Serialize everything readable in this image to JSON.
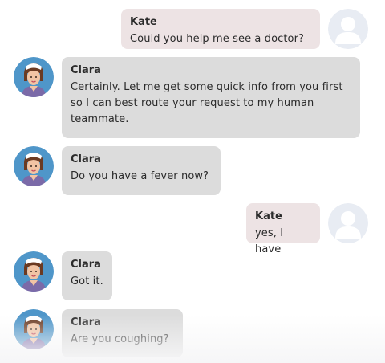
{
  "messages": [
    {
      "sender": "Kate",
      "role": "user",
      "text": "Could you help me see a doctor?"
    },
    {
      "sender": "Clara",
      "role": "bot",
      "text": "Certainly. Let me get some quick info from you first so I can best route your request to my human teammate."
    },
    {
      "sender": "Clara",
      "role": "bot",
      "text": "Do you have a fever now?"
    },
    {
      "sender": "Kate",
      "role": "user",
      "text": "yes, I have"
    },
    {
      "sender": "Clara",
      "role": "bot",
      "text": "Got it."
    },
    {
      "sender": "Clara",
      "role": "bot",
      "text": "Are you coughing?"
    }
  ],
  "colors": {
    "bot_bubble": "#dcdcdc",
    "user_bubble": "#ede3e4",
    "bot_avatar_bg": "#4f96c9",
    "user_avatar_bg": "#e8ecf3"
  },
  "icons": {
    "bot_avatar": "nurse-avatar-icon",
    "user_avatar": "user-placeholder-icon"
  }
}
